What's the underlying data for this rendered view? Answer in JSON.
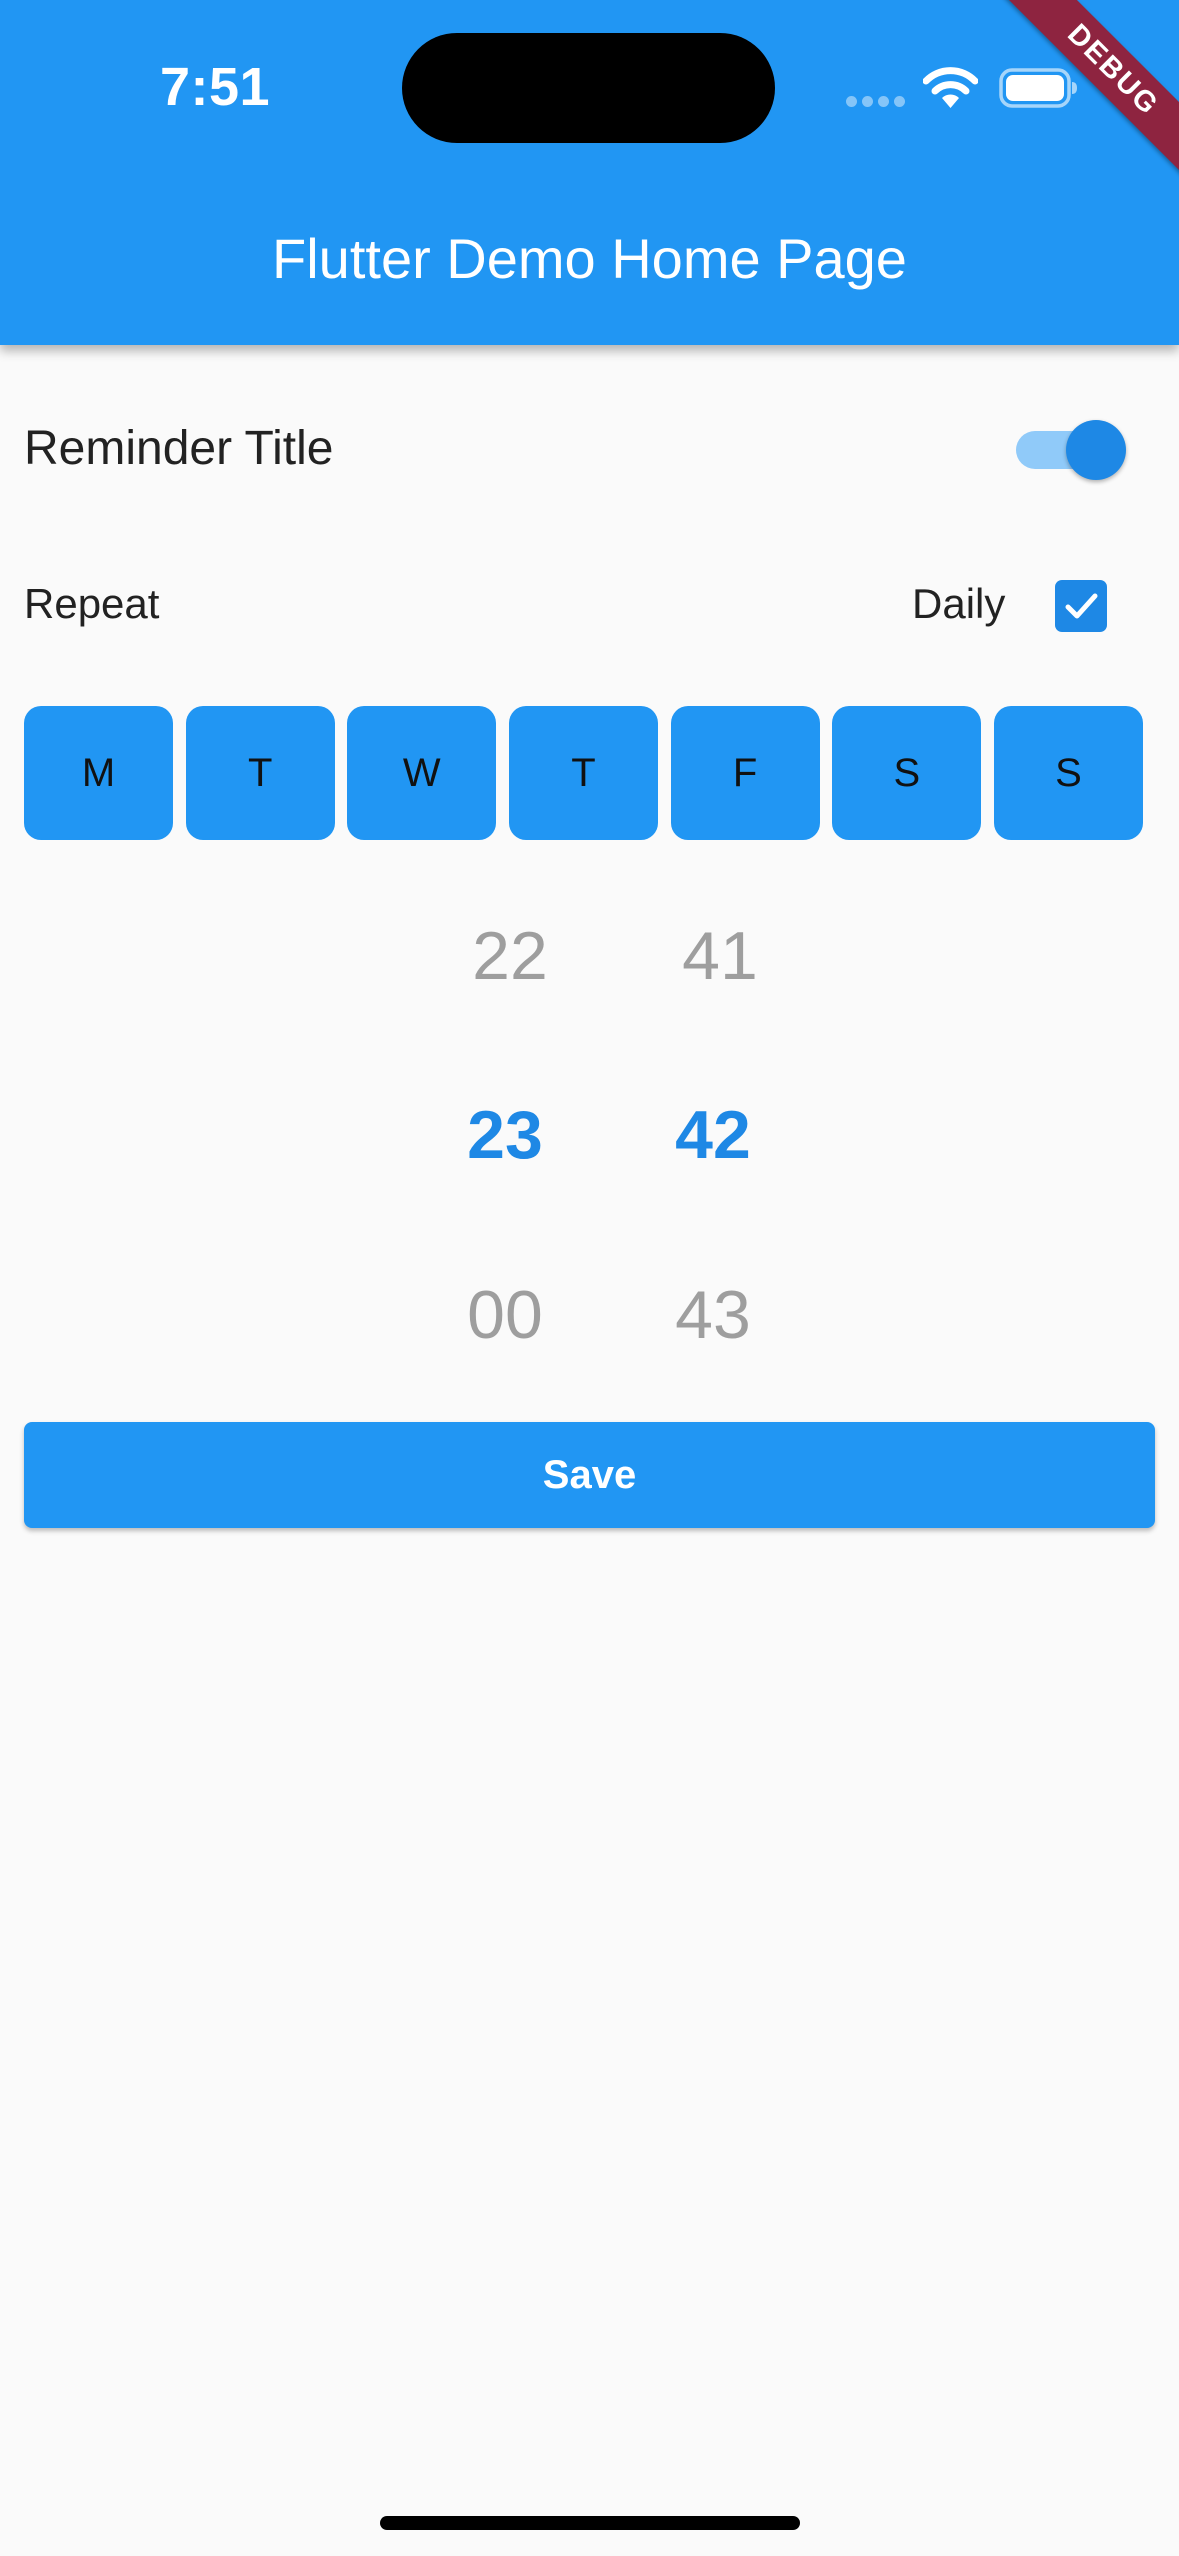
{
  "status_bar": {
    "time": "7:51"
  },
  "app_bar": {
    "title": "Flutter Demo Home Page",
    "debug_banner": "DEBUG"
  },
  "reminder": {
    "title_label": "Reminder Title",
    "enabled": true
  },
  "repeat": {
    "label": "Repeat",
    "daily_label": "Daily",
    "daily_checked": true
  },
  "days": [
    {
      "label": "M"
    },
    {
      "label": "T"
    },
    {
      "label": "W"
    },
    {
      "label": "T"
    },
    {
      "label": "F"
    },
    {
      "label": "S"
    },
    {
      "label": "S"
    }
  ],
  "time_picker": {
    "hours": {
      "prev": "22",
      "selected": "23",
      "next": "00"
    },
    "minutes": {
      "prev": "41",
      "selected": "42",
      "next": "43"
    }
  },
  "actions": {
    "save_label": "Save"
  },
  "colors": {
    "primary": "#2196f3",
    "accent": "#1e88e5",
    "background": "#fafafa",
    "inactive_text": "#9e9e9e"
  }
}
